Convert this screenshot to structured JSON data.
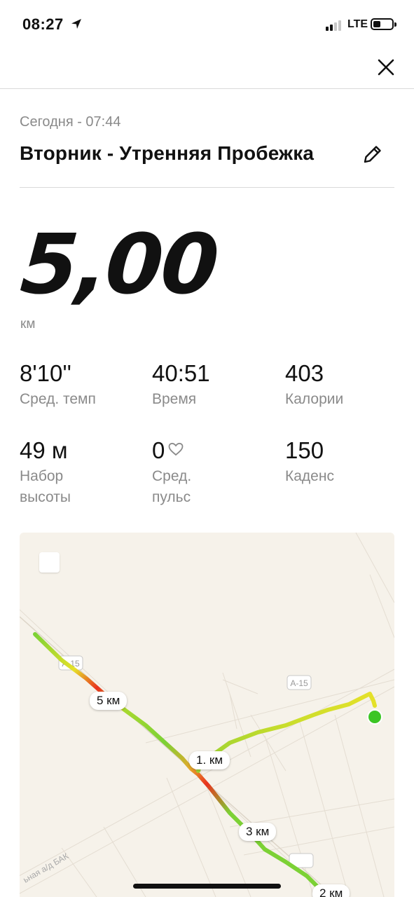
{
  "status_bar": {
    "time": "08:27",
    "network": "LTE"
  },
  "icons": {
    "location_arrow": "location-arrow-icon",
    "close": "close-icon",
    "edit": "pencil-icon",
    "heart": "heart-icon"
  },
  "activity": {
    "date_time": "Сегодня - 07:44",
    "title": "Вторник - Утренняя Пробежка",
    "distance": "5,00",
    "distance_unit": "км"
  },
  "stats": [
    {
      "value": "8'10''",
      "label": "Сред. темп"
    },
    {
      "value": "40:51",
      "label": "Время"
    },
    {
      "value": "403",
      "label": "Калории"
    },
    {
      "value": "49 м",
      "label": "Набор\nвысоты"
    },
    {
      "value": "0",
      "label": "Сред.\nпульс"
    },
    {
      "value": "150",
      "label": "Каденс"
    }
  ],
  "map": {
    "km_markers": [
      "1. км",
      "3 км",
      "2 км",
      "5 км"
    ],
    "road_labels": [
      "А-15",
      "А-15",
      "ьная а/д БАК"
    ],
    "colors": {
      "fast": "#7cd135",
      "medium": "#e6e12a",
      "slow": "#e8321f",
      "start": "#3cc524",
      "end": "#e01414"
    }
  }
}
